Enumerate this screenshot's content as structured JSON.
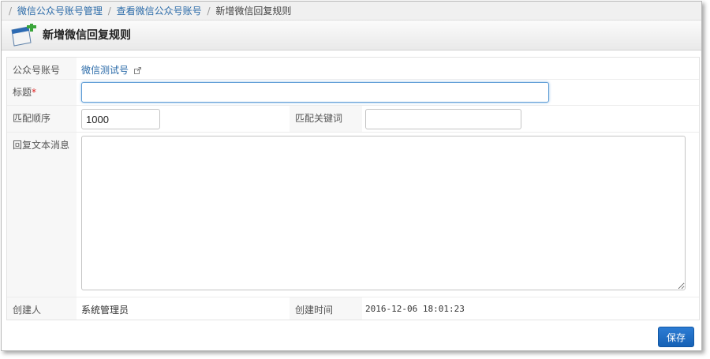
{
  "breadcrumb": {
    "sep": "/",
    "items": [
      "微信公众号账号管理",
      "查看微信公众号账号",
      "新增微信回复规则"
    ]
  },
  "page_title": "新增微信回复规则",
  "form": {
    "account": {
      "label": "公众号账号",
      "value": "微信测试号",
      "icon": "external-link-icon"
    },
    "title": {
      "label": "标题",
      "required_mark": "*",
      "value": ""
    },
    "match_order": {
      "label": "匹配顺序",
      "value": "1000"
    },
    "match_keyword": {
      "label": "匹配关键词",
      "value": ""
    },
    "reply_text": {
      "label": "回复文本消息",
      "value": ""
    },
    "creator": {
      "label": "创建人",
      "value": "系统管理员"
    },
    "created_time": {
      "label": "创建时间",
      "value": "2016-12-06 18:01:23"
    }
  },
  "actions": {
    "save_label": "保存"
  },
  "colors": {
    "link": "#2a6aa8",
    "primary_button": "#1a6cc4",
    "required": "#dd2222"
  }
}
